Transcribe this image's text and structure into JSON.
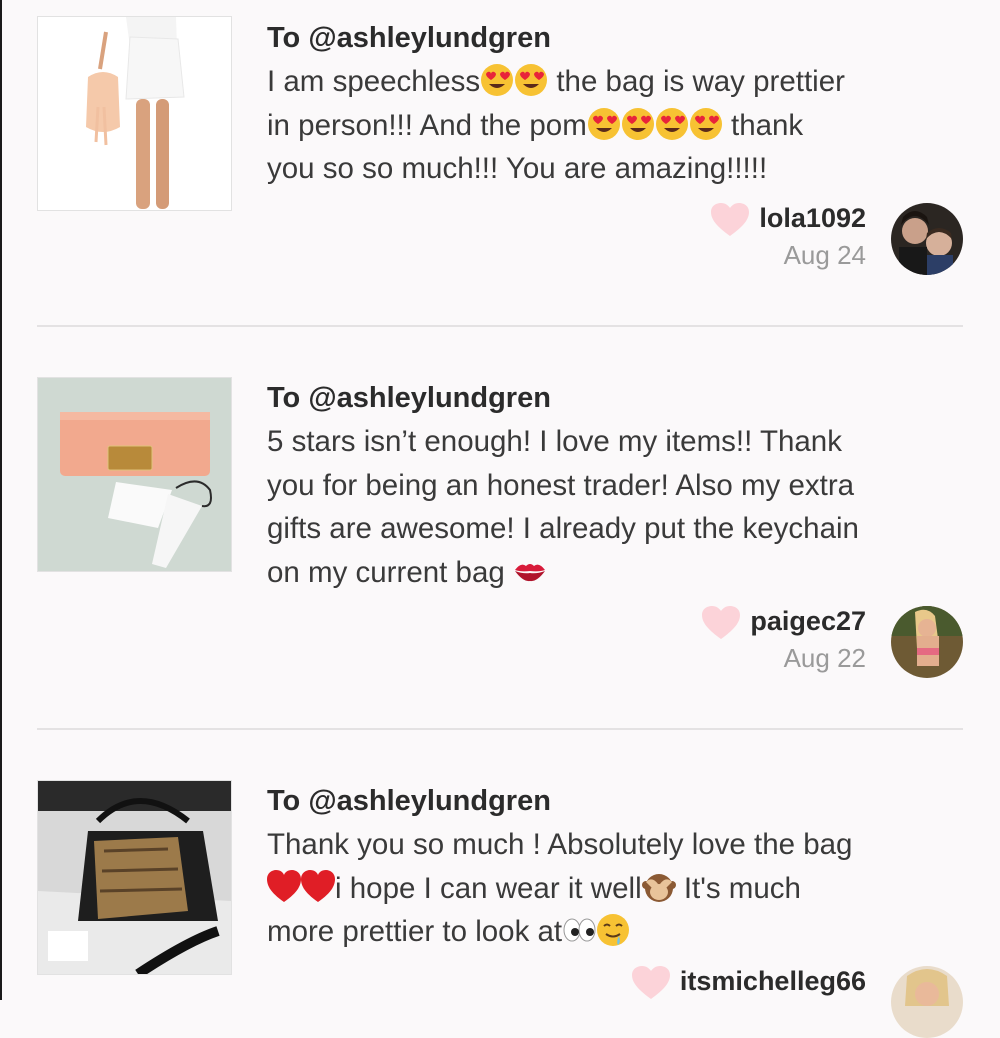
{
  "reviews": [
    {
      "to": "To @ashleylundgren",
      "lines": [
        [
          "I am speechless",
          "E",
          "E",
          " the bag is way prettier"
        ],
        [
          "in person!!! And the pom",
          "E",
          "E",
          "E",
          "E",
          " thank"
        ],
        [
          "you so so much!!! You are amazing!!!!!"
        ]
      ],
      "username": "lola1092",
      "date": "Aug 24"
    },
    {
      "to": "To @ashleylundgren",
      "lines": [
        [
          "5 stars isn’t enough! I love my items!! Thank"
        ],
        [
          "you for being an honest trader! Also my extra"
        ],
        [
          "gifts are awesome! I already put the keychain"
        ],
        [
          "on my current bag ",
          "K"
        ]
      ],
      "username": "paigec27",
      "date": "Aug 22"
    },
    {
      "to": "To @ashleylundgren",
      "lines": [
        [
          "Thank you so much ! Absolutely love the bag"
        ],
        [
          "H",
          "H",
          "i hope I can wear it well",
          "M",
          " It's much"
        ],
        [
          "more prettier to look at",
          "Y",
          "D"
        ]
      ],
      "username": "itsmichelleg66",
      "date": ""
    }
  ],
  "colors": {
    "heart": "#fcd3d9",
    "accent_text": "#2b2b2b",
    "muted_text": "#9a9a9a"
  }
}
